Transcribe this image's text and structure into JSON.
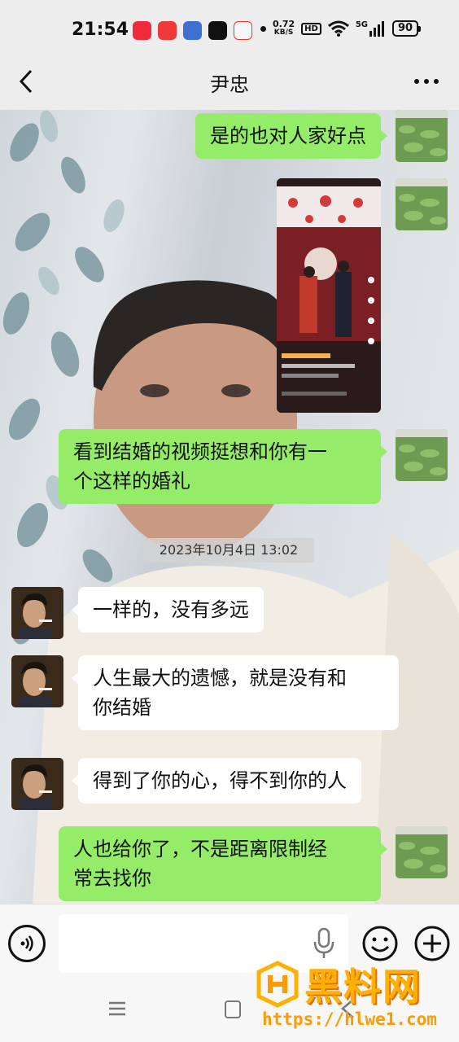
{
  "status_bar": {
    "time": "21:54",
    "network_speed_value": "0.72",
    "network_speed_unit": "KB/S",
    "hd_label": "HD",
    "network_type": "5G",
    "battery": "90",
    "app_icons": [
      "red-app-icon",
      "music-app-icon",
      "blue-app-icon",
      "tiktok-icon",
      "clown-app-icon"
    ]
  },
  "header": {
    "title": "尹忠"
  },
  "chat": {
    "timestamp": "2023年10月4日 13:02",
    "messages": [
      {
        "side": "right",
        "type": "text",
        "text": "是的也对人家好点"
      },
      {
        "side": "right",
        "type": "video"
      },
      {
        "side": "right",
        "type": "text",
        "lines": [
          "看到结婚的视频挺想和你有一",
          "个这样的婚礼"
        ]
      },
      {
        "side": "left",
        "type": "text",
        "text": "一样的，没有多远"
      },
      {
        "side": "left",
        "type": "text",
        "lines": [
          "人生最大的遗憾，就是没有和",
          "你结婚"
        ]
      },
      {
        "side": "left",
        "type": "text",
        "text": "得到了你的心，得不到你的人"
      },
      {
        "side": "right",
        "type": "text",
        "lines": [
          "人也给你了，不是距离限制经",
          "常去找你"
        ]
      }
    ]
  },
  "watermark": {
    "brand": "黑料网",
    "url": "https://hlwe1.com"
  },
  "colors": {
    "sent_bubble": "#95ec69",
    "received_bubble": "#ffffff",
    "background": "#ededed",
    "watermark": "#ffb000"
  }
}
